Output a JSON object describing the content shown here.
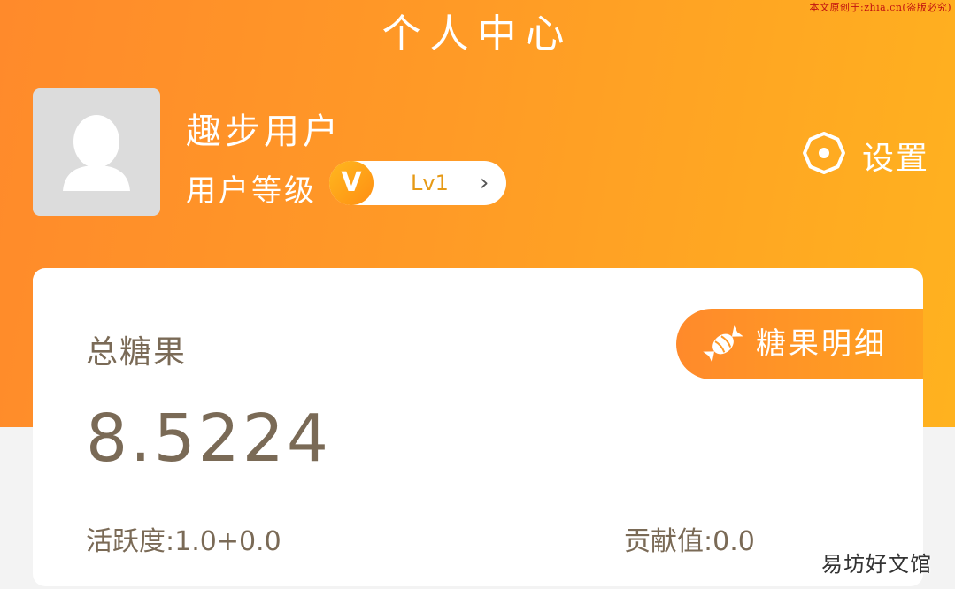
{
  "watermark_top": "本文原创于:zhia.cn(盗版必究)",
  "header": {
    "title": "个人中心"
  },
  "user": {
    "name": "趣步用户",
    "level_label": "用户等级",
    "level_badge": "V",
    "level_value": "Lv1",
    "level_chevron": "›"
  },
  "settings": {
    "label": "设置"
  },
  "candy_card": {
    "total_label": "总糖果",
    "total_value": "8.5224",
    "detail_button": "糖果明细",
    "activity": "活跃度:1.0+0.0",
    "contribution": "贡献值:0.0"
  },
  "watermark_bottom": "易坊好文馆",
  "colors": {
    "header_start": "#ff8a2b",
    "header_end": "#ffb21f",
    "text_brown": "#7a6a56",
    "level_text": "#e69a16"
  }
}
